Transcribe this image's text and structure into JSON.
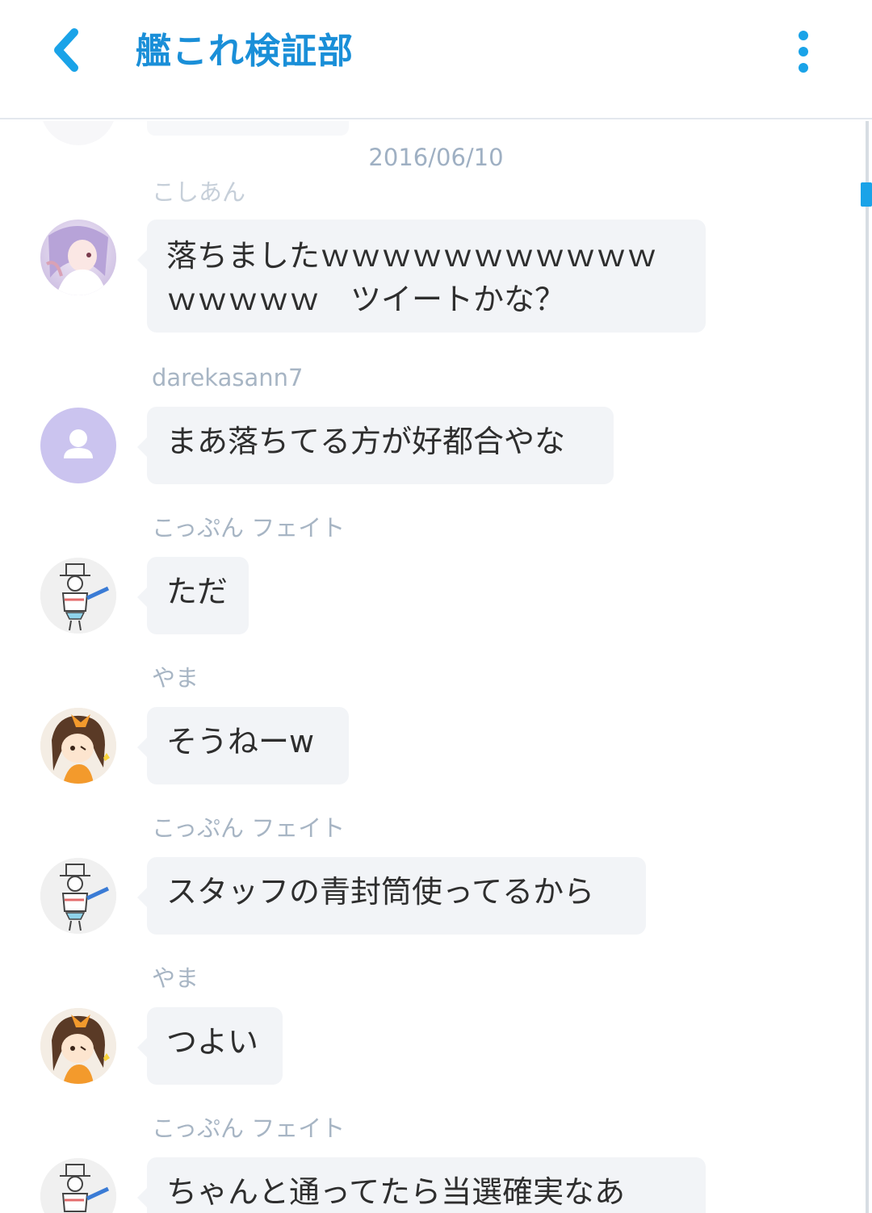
{
  "header": {
    "title": "艦これ検証部",
    "back_icon": "chevron-left-icon",
    "menu_icon": "more-vertical-icon",
    "accent": "#1a8fd8"
  },
  "chat": {
    "date": "2016/06/10",
    "messages": [
      {
        "sender": "こしあん",
        "text_lines": [
          "落ちましたｗｗｗｗｗｗｗｗｗｗｗ",
          "ｗｗｗｗｗ　ツイートかな？"
        ],
        "avatar": "anime-girl-avatar"
      },
      {
        "sender": "darekasann7",
        "text_lines": [
          "まあ落ちてる方が好都合やな"
        ],
        "avatar": "default-user-avatar"
      },
      {
        "sender": "こっぷん フェイト",
        "text_lines": [
          "ただ"
        ],
        "avatar": "sketch-character-avatar"
      },
      {
        "sender": "やま",
        "text_lines": [
          "そうねーw"
        ],
        "avatar": "chibi-girl-avatar"
      },
      {
        "sender": "こっぷん フェイト",
        "text_lines": [
          "スタッフの青封筒使ってるから"
        ],
        "avatar": "sketch-character-avatar"
      },
      {
        "sender": "やま",
        "text_lines": [
          "つよい"
        ],
        "avatar": "chibi-girl-avatar"
      },
      {
        "sender": "こっぷん フェイト",
        "text_lines": [
          "ちゃんと通ってたら当選確実なあ"
        ],
        "avatar": "sketch-character-avatar"
      }
    ]
  }
}
